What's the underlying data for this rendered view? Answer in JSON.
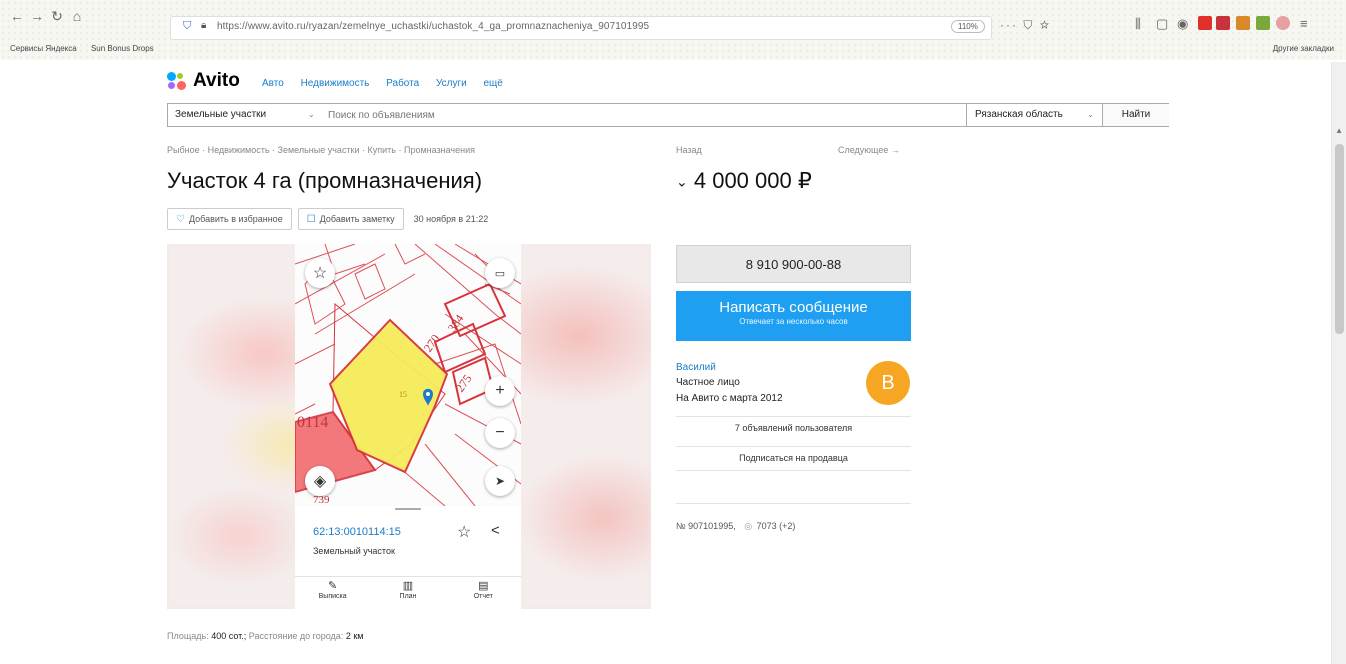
{
  "browser": {
    "url": "https://www.avito.ru/ryazan/zemelnye_uchastki/uchastok_4_ga_promnaznacheniya_907101995",
    "zoom": "110%",
    "bookmarks": [
      "Сервисы Яндекса",
      "Sun Bonus Drops"
    ],
    "bookmarks_right": "Другие закладки"
  },
  "header": {
    "logo": "Avito",
    "nav": [
      "Авто",
      "Недвижимость",
      "Работа",
      "Услуги",
      "ещё"
    ]
  },
  "search": {
    "category": "Земельные участки",
    "placeholder": "Поиск по объявлениям",
    "region": "Рязанская область",
    "button": "Найти"
  },
  "breadcrumbs": "Рыбное · Недвижимость · Земельные участки · Купить · Промназначения",
  "nav_links": {
    "back": "Назад",
    "next": "Следующее →"
  },
  "listing": {
    "title": "Участок 4 га (промназначения)",
    "price": "4 000 000 ₽",
    "favorite": "Добавить в избранное",
    "note": "Добавить заметку",
    "date": "30 ноября в 21:22"
  },
  "map": {
    "cadastral_number": "62:13:0010114:15",
    "parcel_type": "Земельный участок",
    "labels": [
      "384",
      "270",
      "275",
      "0114",
      "739",
      "15"
    ],
    "tabs": [
      "Выписка",
      "План",
      "Отчет"
    ]
  },
  "contact": {
    "phone": "8 910 900-00-88",
    "message_button": "Написать сообщение",
    "message_sub": "Отвечает за несколько часов"
  },
  "seller": {
    "name": "Василий",
    "type": "Частное лицо",
    "since": "На Авито с марта 2012",
    "avatar_letter": "В",
    "ads_link": "7 объявлений пользователя",
    "subscribe": "Подписаться на продавца"
  },
  "ad_meta": {
    "number": "№ 907101995,",
    "views": "7073 (+2)"
  },
  "params": {
    "area_label": "Площадь:",
    "area_value": "400 сот.;",
    "distance_label": "Расстояние до города:",
    "distance_value": "2 км"
  },
  "colors": {
    "accent": "#1e9ff2",
    "link": "#1a7cc8",
    "avatar": "#f7a623",
    "parcel_fill": "#f5ec5a",
    "cadastre_red": "#d8323b"
  }
}
